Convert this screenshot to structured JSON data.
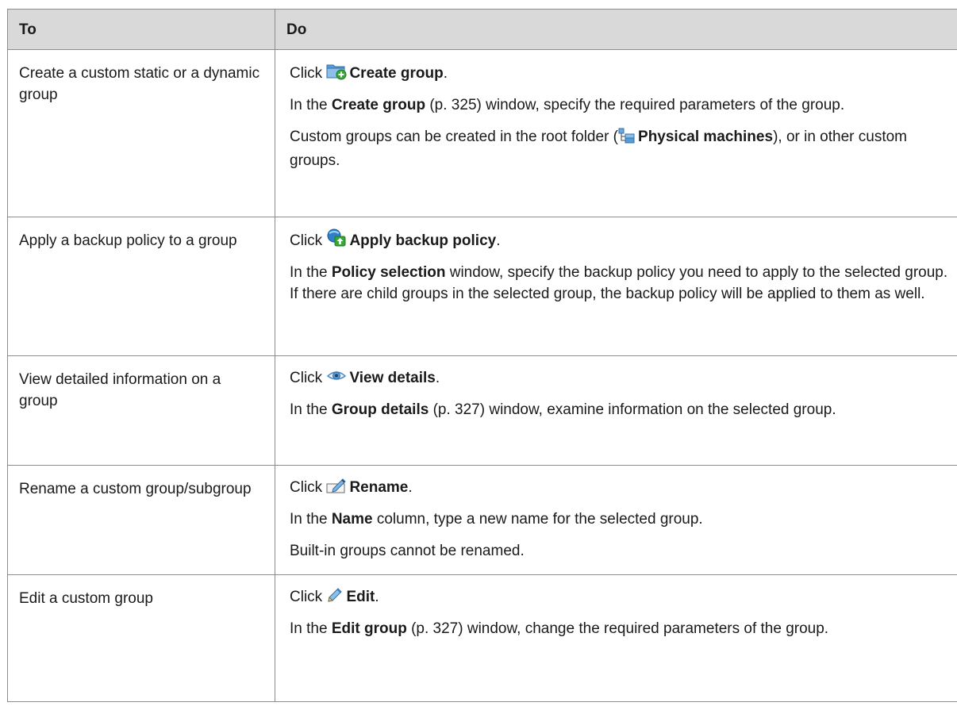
{
  "header": {
    "col_to": "To",
    "col_do": "Do"
  },
  "rows": [
    {
      "to": "Create a custom static or a dynamic group",
      "click_prefix": "Click",
      "action_label": "Create group",
      "icon": "create-group-icon",
      "para1_bold": "Create group",
      "para1_ref": "(p. 325)",
      "para1_rest": "window, specify the required parameters of the group.",
      "para2_pre": "Custom groups can be created in the root folder (",
      "para2_bold": "Physical machines",
      "para2_post": "), or in other custom groups."
    },
    {
      "to": "Apply a backup policy to a group",
      "click_prefix": "Click",
      "action_label": "Apply backup policy",
      "icon": "apply-backup-policy-icon",
      "para1_bold": "Policy selection",
      "para1_rest": "window, specify the backup policy you need to apply to the selected group. If there are child groups in the selected group, the backup policy will be applied to them as well."
    },
    {
      "to": "View detailed information on a group",
      "click_prefix": "Click",
      "action_label": "View details",
      "icon": "eye-icon",
      "para1_bold": "Group details",
      "para1_ref": "(p. 327)",
      "para1_rest": "window, examine information on the selected group."
    },
    {
      "to": "Rename a custom group/subgroup",
      "click_prefix": "Click",
      "action_label": "Rename",
      "icon": "rename-icon",
      "para1_bold": "Name",
      "para1_rest": "column, type a new name for the selected group.",
      "para2": "Built-in groups cannot be renamed."
    },
    {
      "to": "Edit a custom group",
      "click_prefix": "Click",
      "action_label": "Edit",
      "icon": "pencil-icon",
      "para1_bold": "Edit group",
      "para1_ref": "(p. 327)",
      "para1_rest": "window, change the required parameters of the group."
    }
  ],
  "common": {
    "in_the": "In the"
  }
}
